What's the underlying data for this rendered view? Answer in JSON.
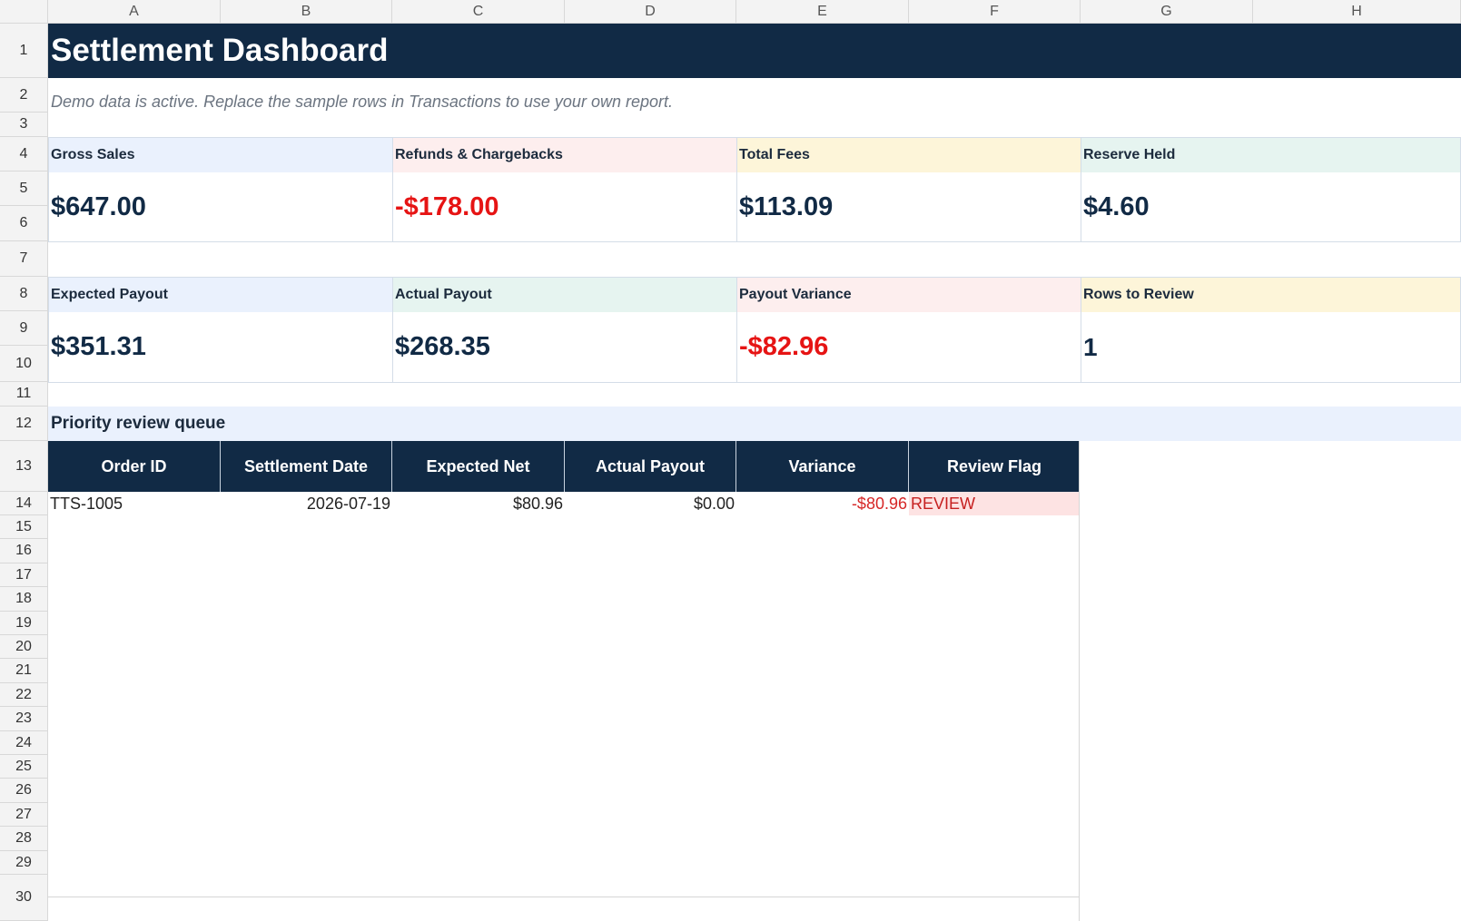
{
  "columns": [
    "A",
    "B",
    "C",
    "D",
    "E",
    "F",
    "G",
    "H"
  ],
  "rows": [
    "1",
    "2",
    "3",
    "4",
    "5",
    "6",
    "7",
    "8",
    "9",
    "10",
    "11",
    "12",
    "13",
    "14",
    "15",
    "16",
    "17",
    "18",
    "19",
    "20",
    "21",
    "22",
    "23",
    "24",
    "25",
    "26",
    "27",
    "28",
    "29",
    "30"
  ],
  "title": "Settlement Dashboard",
  "subtitle": "Demo data is active. Replace the sample rows in Transactions to use your own report.",
  "kpi_row1": [
    {
      "label": "Gross Sales",
      "value": "$647.00",
      "accent": "#eaf1fd",
      "negative": false
    },
    {
      "label": "Refunds & Chargebacks",
      "value": "-$178.00",
      "accent": "#fdeeee",
      "negative": true
    },
    {
      "label": "Total Fees",
      "value": "$113.09",
      "accent": "#fdf5d9",
      "negative": false
    },
    {
      "label": "Reserve Held",
      "value": "$4.60",
      "accent": "#e6f4f0",
      "negative": false
    }
  ],
  "kpi_row2": [
    {
      "label": "Expected Payout",
      "value": "$351.31",
      "accent": "#eaf1fd",
      "negative": false
    },
    {
      "label": "Actual Payout",
      "value": "$268.35",
      "accent": "#e6f4f0",
      "negative": false
    },
    {
      "label": "Payout Variance",
      "value": "-$82.96",
      "accent": "#fdeeee",
      "negative": true
    },
    {
      "label": "Rows to Review",
      "value": "1",
      "accent": "#fdf5d9",
      "negative": false
    }
  ],
  "review_section": {
    "title": "Priority review queue",
    "headers": [
      "Order ID",
      "Settlement Date",
      "Expected Net",
      "Actual Payout",
      "Variance",
      "Review Flag"
    ],
    "rows": [
      {
        "order_id": "TTS-1005",
        "settlement_date": "2026-07-19",
        "expected_net": "$80.96",
        "actual_payout": "$0.00",
        "variance": "-$80.96",
        "review_flag": "REVIEW"
      }
    ]
  },
  "colors": {
    "header_navy": "#112a45",
    "negative_red": "#e61414",
    "flag_bg": "#fde3e3"
  }
}
